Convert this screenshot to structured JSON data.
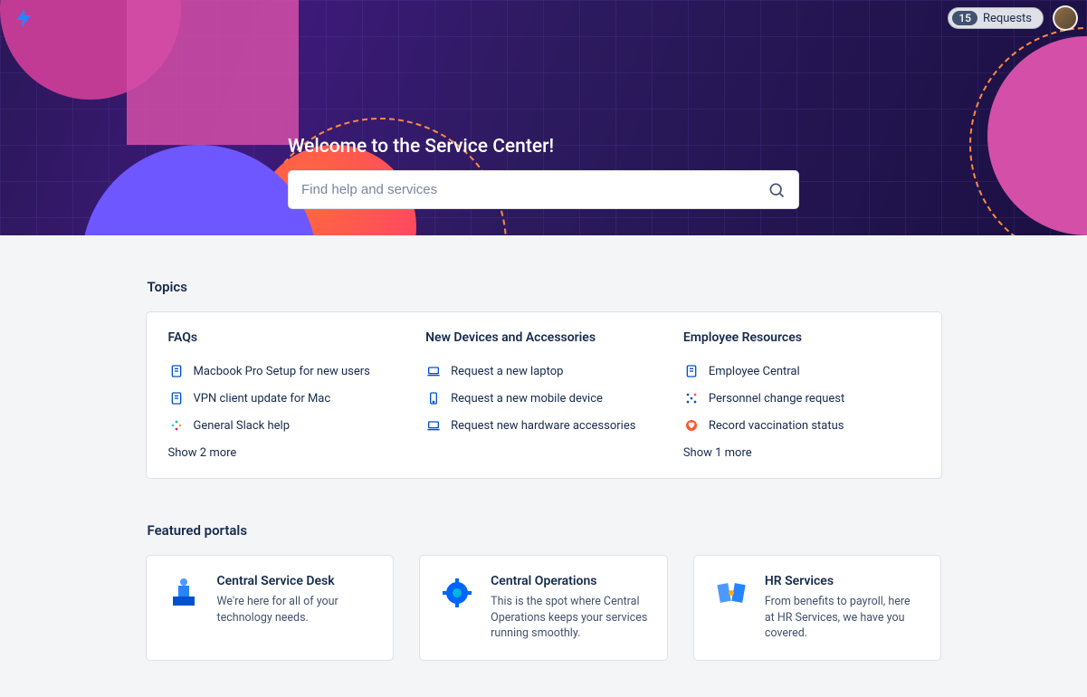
{
  "header": {
    "requests_count": "15",
    "requests_label": "Requests"
  },
  "hero": {
    "title": "Welcome to the Service Center!",
    "search_placeholder": "Find help and services"
  },
  "topics": {
    "heading": "Topics",
    "columns": [
      {
        "title": "FAQs",
        "items": [
          {
            "icon": "doc",
            "label": "Macbook Pro Setup for new users"
          },
          {
            "icon": "doc",
            "label": "VPN client update for Mac"
          },
          {
            "icon": "slack",
            "label": "General Slack help"
          }
        ],
        "show_more": "Show 2 more"
      },
      {
        "title": "New Devices and Accessories",
        "items": [
          {
            "icon": "laptop",
            "label": "Request a new laptop"
          },
          {
            "icon": "phone",
            "label": "Request a new mobile device"
          },
          {
            "icon": "laptop",
            "label": "Request new hardware accessories"
          }
        ],
        "show_more": ""
      },
      {
        "title": "Employee Resources",
        "items": [
          {
            "icon": "doc",
            "label": "Employee Central"
          },
          {
            "icon": "network",
            "label": "Personnel change request"
          },
          {
            "icon": "heart",
            "label": "Record vaccination status"
          }
        ],
        "show_more": "Show 1 more"
      }
    ]
  },
  "portals": {
    "heading": "Featured portals",
    "cards": [
      {
        "title": "Central Service Desk",
        "desc": "We're here for all of your technology needs.",
        "icon": "desk"
      },
      {
        "title": "Central Operations",
        "desc": "This is the spot where Central Operations keeps your services running smoothly.",
        "icon": "gear"
      },
      {
        "title": "HR Services",
        "desc": "From benefits to payroll, here at HR Services, we have you covered.",
        "icon": "hr"
      }
    ]
  }
}
